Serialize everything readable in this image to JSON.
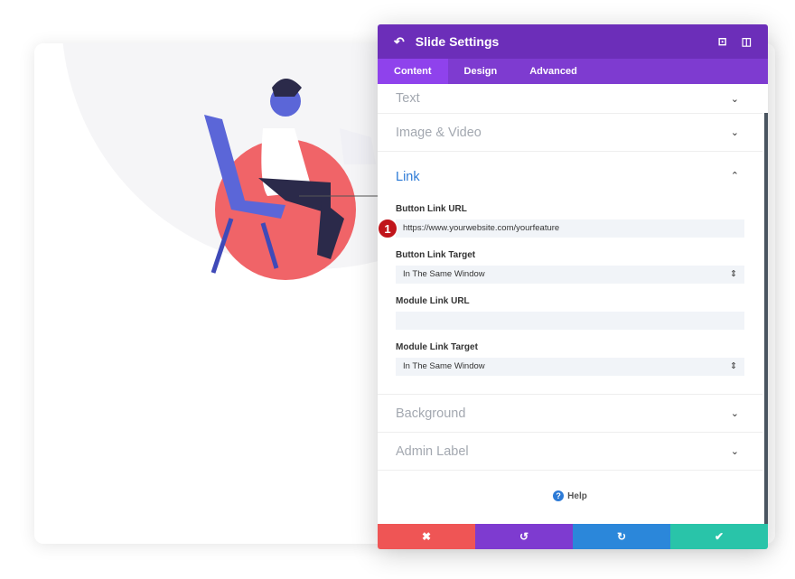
{
  "panel": {
    "title": "Slide Settings",
    "tabs": [
      {
        "label": "Content"
      },
      {
        "label": "Design"
      },
      {
        "label": "Advanced"
      }
    ]
  },
  "sections": {
    "text": "Text",
    "image_video": "Image & Video",
    "link": "Link",
    "background": "Background",
    "admin_label": "Admin Label"
  },
  "link": {
    "button_url_label": "Button Link URL",
    "button_url_value": "https://www.yourwebsite.com/yourfeature",
    "step_badge": "1",
    "button_target_label": "Button Link Target",
    "button_target_value": "In The Same Window",
    "module_url_label": "Module Link URL",
    "module_url_value": "",
    "module_target_label": "Module Link Target",
    "module_target_value": "In The Same Window"
  },
  "help": "Help",
  "colors": {
    "header": "#6c2eb9",
    "tabs": "#7e3bd0",
    "cancel": "#ef5555",
    "undo": "#7e3bd0",
    "redo": "#2b87da",
    "save": "#29c4a9",
    "accent_link": "#2c7ad6"
  }
}
